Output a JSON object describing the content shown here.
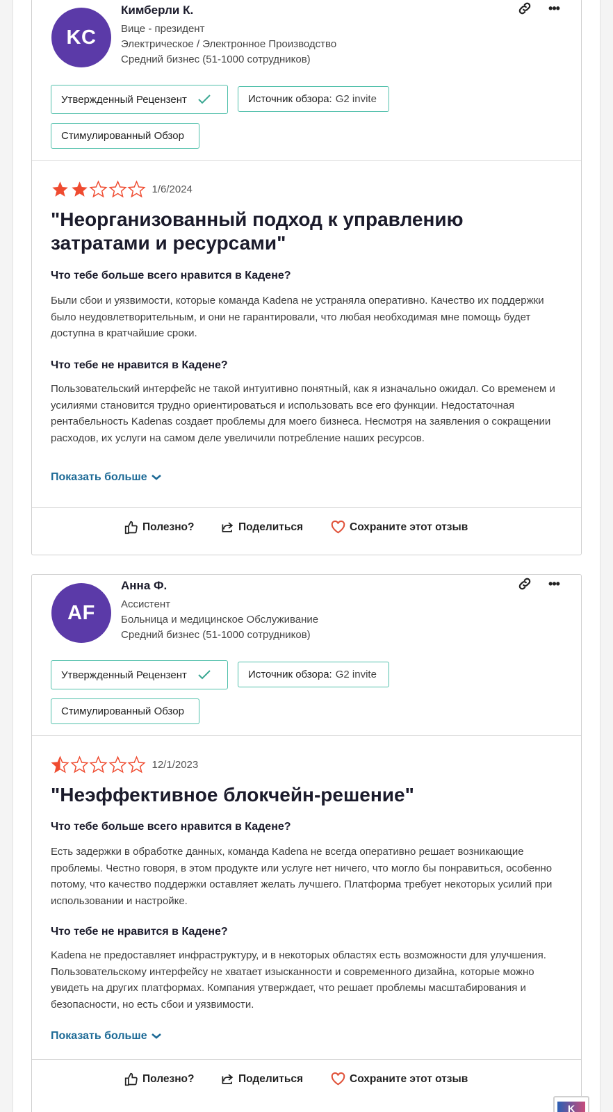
{
  "reviews": [
    {
      "avatar_initials": "KC",
      "name": "Кимберли К.",
      "role": "Вице - президент",
      "industry": "Электрическое / Электронное Производство",
      "company_size": "Средний бизнес (51-1000 сотрудников)",
      "badges": {
        "verified": "Утвержденный Рецензент",
        "source_label": "Источник обзора:",
        "source_value": "G2 invite",
        "incentivized": "Стимулированный Обзор"
      },
      "rating": 2,
      "date": "1/6/2024",
      "title": "\"Неорганизованный подход к управлению затратами и ресурсами\"",
      "q_like": "Что тебе больше всего нравится в Кадене?",
      "a_like": "Были сбои и уязвимости, которые команда Kadena не устраняла оперативно. Качество их поддержки было неудовлетворительным, и они не гарантировали, что любая необходимая мне помощь будет доступна в кратчайшие сроки.",
      "q_dislike": "Что тебе не нравится в Кадене?",
      "a_dislike": "Пользовательский интерфейс не такой интуитивно понятный, как я изначально ожидал. Со временем и усилиями становится трудно ориентироваться и использовать все его функции. Недостаточная рентабельность Kadenas создает проблемы для моего бизнеса. Несмотря на заявления о сокращении расходов, их услуги на самом деле увеличили потребление наших ресурсов.",
      "show_more": "Показать больше"
    },
    {
      "avatar_initials": "AF",
      "name": "Анна Ф.",
      "role": "Ассистент",
      "industry": "Больница и медицинское Обслуживание",
      "company_size": "Средний бизнес (51-1000 сотрудников)",
      "badges": {
        "verified": "Утвержденный Рецензент",
        "source_label": "Источник обзора:",
        "source_value": "G2 invite",
        "incentivized": "Стимулированный Обзор"
      },
      "rating": 0.5,
      "date": "12/1/2023",
      "title": "\"Неэффективное блокчейн-решение\"",
      "q_like": "Что тебе больше всего нравится в Кадене?",
      "a_like": "Есть задержки в обработке данных, команда Kadena не всегда оперативно решает возникающие проблемы. Честно говоря, в этом продукте или услуге нет ничего, что могло бы понравиться, особенно потому, что качество поддержки оставляет желать лучшего. Платформа требует некоторых усилий при использовании и настройке.",
      "q_dislike": "Что тебе не нравится в Кадене?",
      "a_dislike": "Kadena не предоставляет инфраструктуру, и в некоторых областях есть возможности для улучшения. Пользовательскому интерфейсу не хватает изысканности и современного дизайна, которые можно увидеть на других платформах. Компания утверждает, что решает проблемы масштабирования и безопасности, но есть сбои и уязвимости.",
      "show_more": "Показать больше"
    }
  ],
  "actions": {
    "helpful": "Полезно?",
    "share": "Поделиться",
    "save": "Сохраните этот отзыв"
  },
  "colors": {
    "star": "#ef4b30",
    "avatar": "#5b3aa8",
    "badge_border": "#4fbfaa",
    "link": "#1d6a96",
    "heart": "#e0523a"
  },
  "icons": [
    "link-icon",
    "more-icon",
    "check-icon",
    "star-icon",
    "chevron-down-icon",
    "thumbs-up-icon",
    "share-icon",
    "heart-icon"
  ]
}
